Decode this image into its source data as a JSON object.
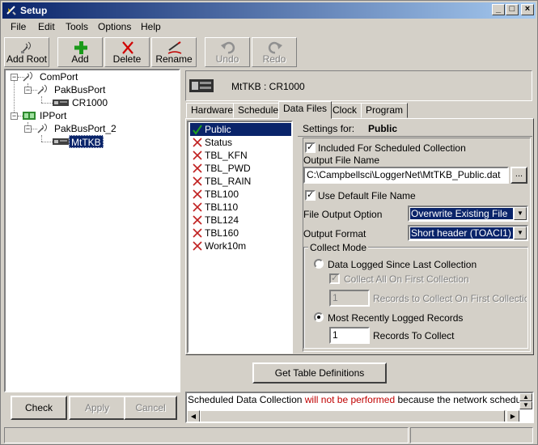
{
  "window": {
    "title": "Setup",
    "controls": {
      "minimize": "_",
      "maximize": "□",
      "close": "×"
    }
  },
  "menu": [
    {
      "label": "File"
    },
    {
      "label": "Edit"
    },
    {
      "label": "Tools"
    },
    {
      "label": "Options"
    },
    {
      "label": "Help"
    }
  ],
  "toolbar": {
    "add_root": "Add Root",
    "add": "Add",
    "delete": "Delete",
    "rename": "Rename",
    "undo": "Undo",
    "redo": "Redo"
  },
  "tree": {
    "comport": "ComPort",
    "pakbusport": "PakBusPort",
    "cr1000": "CR1000",
    "ipport": "IPPort",
    "pakbusport_2": "PakBusPort_2",
    "mtkb": "MtTKB"
  },
  "left_buttons": {
    "check": "Check",
    "apply": "Apply",
    "cancel": "Cancel"
  },
  "device_header": "MtTKB : CR1000",
  "tabs": [
    {
      "label": "Hardware"
    },
    {
      "label": "Schedule"
    },
    {
      "label": "Data Files"
    },
    {
      "label": "Clock"
    },
    {
      "label": "Program"
    }
  ],
  "tables": [
    {
      "label": "Public",
      "status": "check"
    },
    {
      "label": "Status",
      "status": "x"
    },
    {
      "label": "TBL_KFN",
      "status": "x"
    },
    {
      "label": "TBL_PWD",
      "status": "x"
    },
    {
      "label": "TBL_RAIN",
      "status": "x"
    },
    {
      "label": "TBL100",
      "status": "x"
    },
    {
      "label": "TBL110",
      "status": "x"
    },
    {
      "label": "TBL124",
      "status": "x"
    },
    {
      "label": "TBL160",
      "status": "x"
    },
    {
      "label": "Work10m",
      "status": "x"
    }
  ],
  "settings": {
    "settings_for_label": "Settings for:",
    "settings_for_value": "Public",
    "included_label": "Included For Scheduled Collection",
    "output_file_label": "Output File Name",
    "output_file_value": "C:\\Campbellsci\\LoggerNet\\MtTKB_Public.dat",
    "browse": "...",
    "use_default_label": "Use Default File Name",
    "file_output_option_label": "File Output Option",
    "file_output_option_value": "Overwrite Existing File",
    "output_format_label": "Output Format",
    "output_format_value": "Short header (TOACI1)",
    "collect_mode_label": "Collect Mode",
    "since_last_label": "Data Logged Since Last Collection",
    "collect_all_label": "Collect All On First Collection",
    "records_first_value": "1",
    "records_first_label": "Records to Collect On First Collection",
    "most_recent_label": "Most Recently Logged Records",
    "records_value": "1",
    "records_label": "Records To Collect"
  },
  "get_table_button": "Get Table Definitions",
  "log": {
    "prefix": "Scheduled Data Collection ",
    "highlight": "will not be performed",
    "suffix": "  because the network schedule is paused",
    "highlight_color": "#c00000"
  }
}
